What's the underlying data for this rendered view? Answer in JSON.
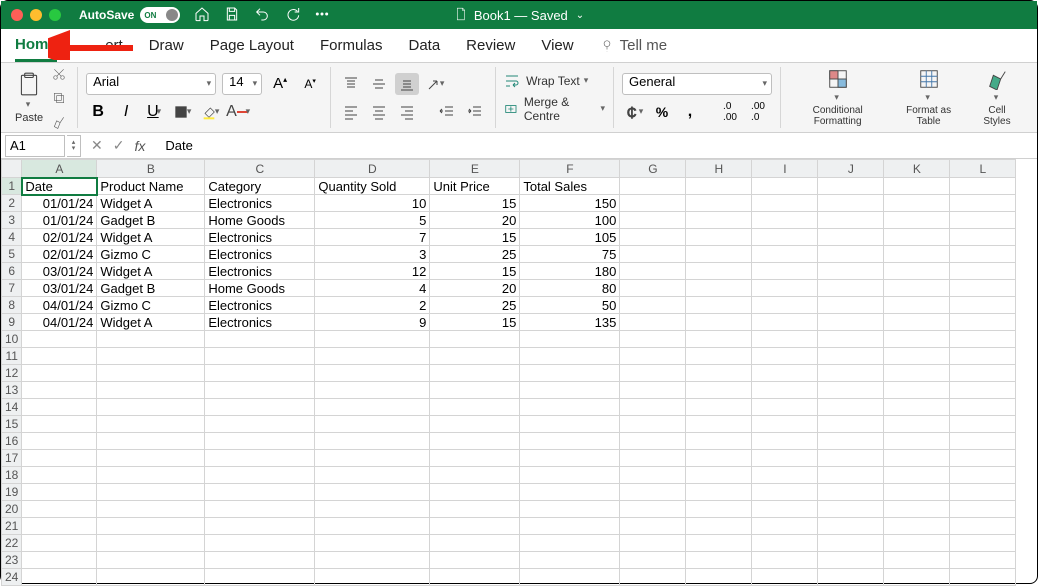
{
  "titlebar": {
    "autosave_label": "AutoSave",
    "autosave_state": "ON",
    "doc_title": "Book1 — Saved"
  },
  "tabs": {
    "home": "Home",
    "insert": "Insert",
    "draw": "Draw",
    "page_layout": "Page Layout",
    "formulas": "Formulas",
    "data": "Data",
    "review": "Review",
    "view": "View",
    "tellme": "Tell me"
  },
  "ribbon": {
    "paste_label": "Paste",
    "font_name": "Arial",
    "font_size": "14",
    "wrap_text": "Wrap Text",
    "merge_centre": "Merge & Centre",
    "number_format": "General",
    "cond_fmt": "Conditional\nFormatting",
    "fmt_table": "Format\nas Table",
    "cell_styles": "Cell\nStyles"
  },
  "fbar": {
    "name": "A1",
    "value": "Date"
  },
  "columns": [
    "A",
    "B",
    "C",
    "D",
    "E",
    "F",
    "G",
    "H",
    "I",
    "J",
    "K",
    "L"
  ],
  "headers": [
    "Date",
    "Product Name",
    "Category",
    "Quantity Sold",
    "Unit Price",
    "Total Sales"
  ],
  "rows": [
    {
      "date": "01/01/24",
      "product": "Widget A",
      "category": "Electronics",
      "qty": 10,
      "price": 15,
      "total": 150
    },
    {
      "date": "01/01/24",
      "product": "Gadget B",
      "category": "Home Goods",
      "qty": 5,
      "price": 20,
      "total": 100
    },
    {
      "date": "02/01/24",
      "product": "Widget A",
      "category": "Electronics",
      "qty": 7,
      "price": 15,
      "total": 105
    },
    {
      "date": "02/01/24",
      "product": "Gizmo C",
      "category": "Electronics",
      "qty": 3,
      "price": 25,
      "total": 75
    },
    {
      "date": "03/01/24",
      "product": "Widget A",
      "category": "Electronics",
      "qty": 12,
      "price": 15,
      "total": 180
    },
    {
      "date": "03/01/24",
      "product": "Gadget B",
      "category": "Home Goods",
      "qty": 4,
      "price": 20,
      "total": 80
    },
    {
      "date": "04/01/24",
      "product": "Gizmo C",
      "category": "Electronics",
      "qty": 2,
      "price": 25,
      "total": 50
    },
    {
      "date": "04/01/24",
      "product": "Widget A",
      "category": "Electronics",
      "qty": 9,
      "price": 15,
      "total": 135
    }
  ],
  "total_display_rows": 24
}
